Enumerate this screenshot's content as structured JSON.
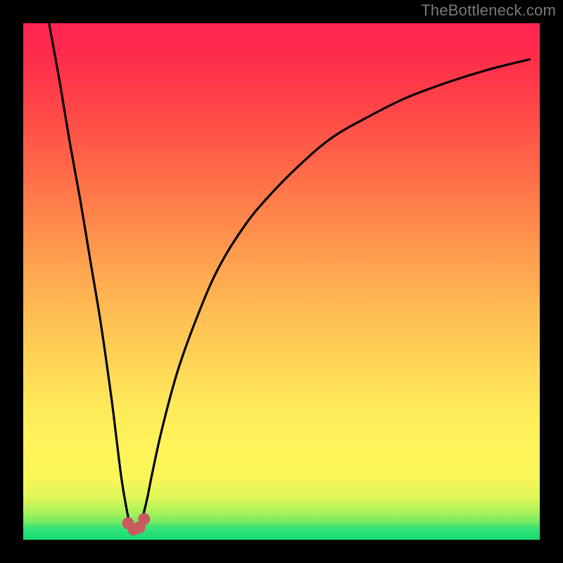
{
  "watermark": "TheBottleneck.com",
  "chart_data": {
    "type": "line",
    "title": "",
    "xlabel": "",
    "ylabel": "",
    "xlim": [
      0,
      100
    ],
    "ylim": [
      0,
      100
    ],
    "grid": false,
    "legend": false,
    "series": [
      {
        "name": "bottleneck-curve",
        "x": [
          5,
          7,
          9,
          11,
          13,
          15,
          17,
          18,
          19,
          20,
          20.8,
          21.5,
          22.3,
          23,
          24,
          25,
          27,
          30,
          34,
          38,
          43,
          48,
          54,
          60,
          67,
          74,
          82,
          90,
          98
        ],
        "y": [
          100,
          89,
          77,
          66,
          54,
          42,
          28,
          20,
          12,
          6,
          2.5,
          1.8,
          2.2,
          4,
          8,
          13,
          22,
          33,
          44,
          53,
          61,
          67,
          73,
          78,
          82,
          85.5,
          88.5,
          91,
          93
        ]
      }
    ],
    "markers": [
      {
        "x": 20.3,
        "y": 3.2
      },
      {
        "x": 21.4,
        "y": 2.0
      },
      {
        "x": 22.5,
        "y": 2.4
      },
      {
        "x": 23.4,
        "y": 4.0
      }
    ],
    "background": "rainbow-vertical-gradient",
    "curve_color": "#000000",
    "marker_color": "#cb5a60"
  }
}
